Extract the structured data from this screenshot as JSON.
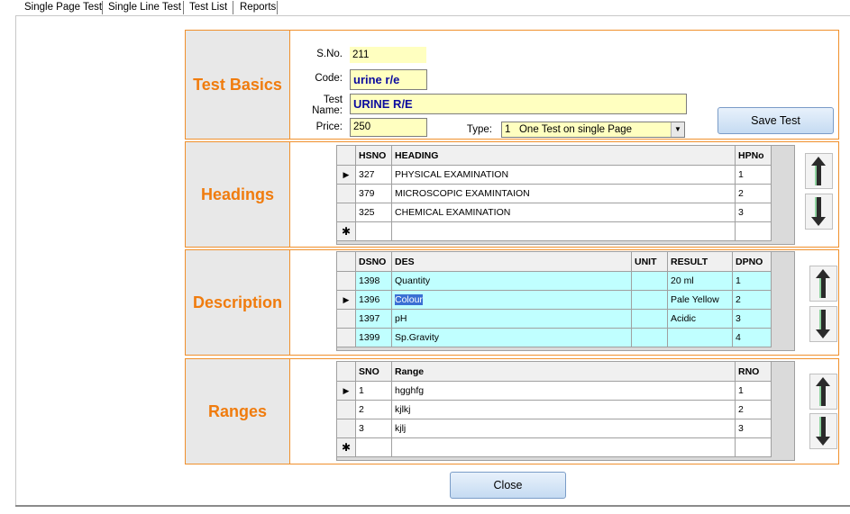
{
  "tabs": [
    "Single Page Test",
    "Single Line Test",
    "Test List",
    "Reports"
  ],
  "basics": {
    "label": "Test Basics",
    "sno_label": "S.No.",
    "sno": "211",
    "code_label": "Code:",
    "code": "urine r/e",
    "name_label": "Test Name:",
    "name": "URINE R/E",
    "price_label": "Price:",
    "price": "250",
    "type_label": "Type:",
    "type_value": "1   One Test on single Page",
    "save": "Save Test"
  },
  "headings": {
    "label": "Headings",
    "columns": [
      "HSNO",
      "HEADING",
      "HPNo"
    ],
    "rows": [
      [
        "327",
        "PHYSICAL EXAMINATION",
        "1"
      ],
      [
        "379",
        "MICROSCOPIC EXAMINTAION",
        "2"
      ],
      [
        "325",
        "CHEMICAL EXAMINATION",
        "3"
      ]
    ],
    "new_row_marker": "✱"
  },
  "description": {
    "label": "Description",
    "columns": [
      "DSNO",
      "DES",
      "UNIT",
      "RESULT",
      "DPNO"
    ],
    "rows": [
      [
        "1398",
        "Quantity",
        "",
        "20 ml",
        "1"
      ],
      [
        "1396",
        "Colour",
        "",
        "Pale Yellow",
        "2"
      ],
      [
        "1397",
        "pH",
        "",
        "Acidic",
        "3"
      ],
      [
        "1399",
        "Sp.Gravity",
        "",
        "",
        "4"
      ]
    ]
  },
  "ranges": {
    "label": "Ranges",
    "columns": [
      "SNO",
      "Range",
      "RNO"
    ],
    "rows": [
      [
        "1",
        "hgghfg",
        "1"
      ],
      [
        "2",
        "kjlkj",
        "2"
      ],
      [
        "3",
        "kjlj",
        "3"
      ]
    ],
    "new_row_marker": "✱"
  },
  "close": "Close",
  "row_pointer": "▶"
}
